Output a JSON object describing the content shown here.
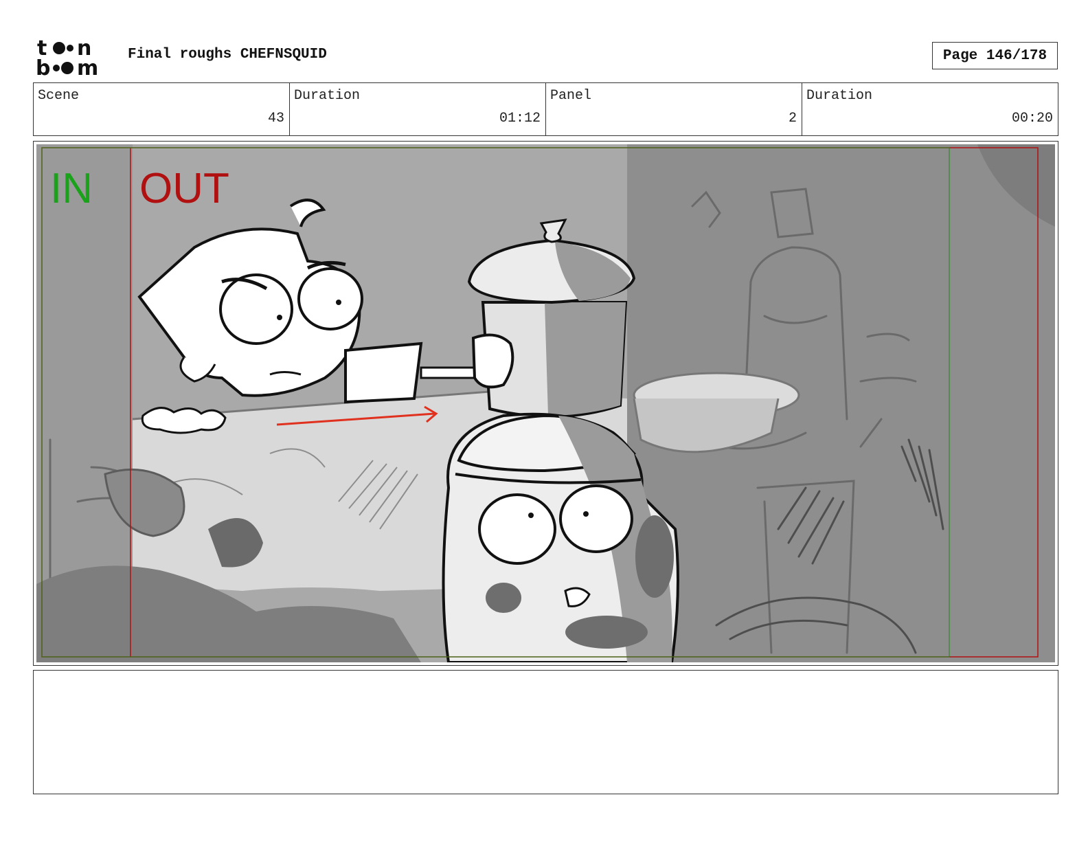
{
  "header": {
    "title": "Final roughs CHEFNSQUID",
    "page": "Page 146/178"
  },
  "info": {
    "scene_label": "Scene",
    "scene_value": "43",
    "scene_duration_label": "Duration",
    "scene_duration_value": "01:12",
    "panel_label": "Panel",
    "panel_value": "2",
    "panel_duration_label": "Duration",
    "panel_duration_value": "00:20"
  },
  "panel_marks": {
    "in_label": "IN",
    "out_label": "OUT",
    "in_color": "#1aa31a",
    "out_color": "#b01010"
  },
  "notes": {
    "text": ""
  }
}
